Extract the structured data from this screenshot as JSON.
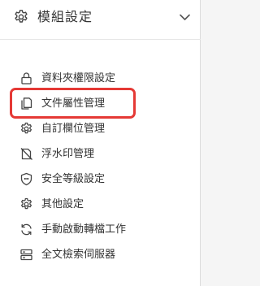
{
  "menu": {
    "title": "模組設定",
    "items": [
      {
        "label": "資料夾權限設定",
        "icon": "lock-icon",
        "highlighted": false
      },
      {
        "label": "文件屬性管理",
        "icon": "document-icon",
        "highlighted": true
      },
      {
        "label": "自訂欄位管理",
        "icon": "gear-icon",
        "highlighted": false
      },
      {
        "label": "浮水印管理",
        "icon": "watermark-icon",
        "highlighted": false
      },
      {
        "label": "安全等級設定",
        "icon": "shield-icon",
        "highlighted": false
      },
      {
        "label": "其他設定",
        "icon": "gear-icon",
        "highlighted": false
      },
      {
        "label": "手動啟動轉檔工作",
        "icon": "refresh-icon",
        "highlighted": false
      },
      {
        "label": "全文檢索伺服器",
        "icon": "server-icon",
        "highlighted": false
      }
    ]
  },
  "colors": {
    "highlight": "#e53935",
    "text": "#333333",
    "panel_bg": "#ffffff",
    "page_bg": "#f5f5f5"
  }
}
